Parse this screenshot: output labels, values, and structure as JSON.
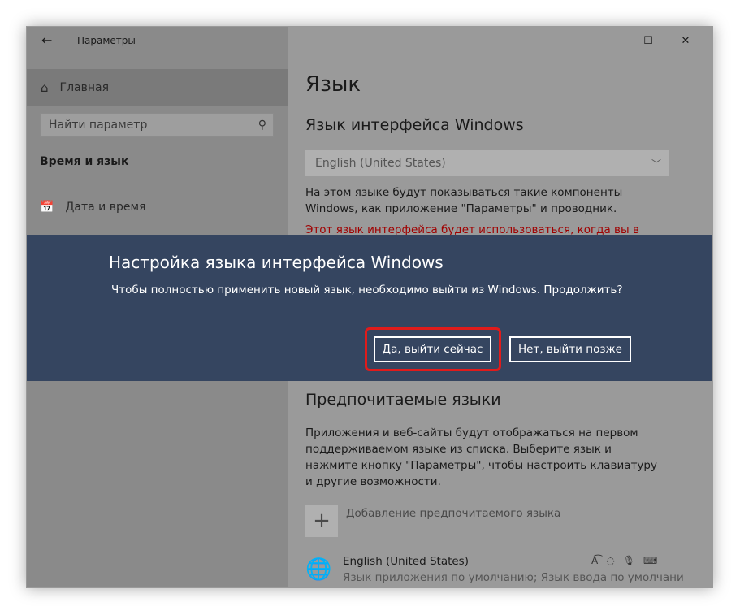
{
  "window": {
    "title": "Параметры",
    "back_glyph": "←",
    "controls": {
      "minimize": "—",
      "maximize": "☐",
      "close": "✕"
    }
  },
  "sidebar": {
    "home_label": "Главная",
    "search_placeholder": "Найти параметр",
    "section_title": "Время и язык",
    "items": [
      {
        "label": "Дата и время",
        "icon": "calendar-clock-icon"
      }
    ]
  },
  "main": {
    "heading": "Язык",
    "interface_language_heading": "Язык интерфейса Windows",
    "interface_language_value": "English (United States)",
    "interface_language_desc": "На этом языке будут показываться такие компоненты Windows, как приложение \"Параметры\" и проводник.",
    "interface_language_warning": "Этот язык интерфейса будет использоваться, когда вы в",
    "preferred_heading": "Предпочитаемые языки",
    "preferred_desc": "Приложения и веб-сайты будут отображаться на первом поддерживаемом языке из списка. Выберите язык и нажмите кнопку \"Параметры\", чтобы настроить клавиатуру и другие возможности.",
    "add_language_label": "Добавление предпочитаемого языка",
    "languages": [
      {
        "name": "English (United States)",
        "subtitle": "Язык приложения по умолчанию; Язык ввода по умолчани"
      }
    ]
  },
  "dialog": {
    "title": "Настройка языка интерфейса Windows",
    "message": "Чтобы полностью применить новый язык, необходимо выйти из Windows. Продолжить?",
    "yes_label": "Да, выйти сейчас",
    "no_label": "Нет, выйти позже"
  },
  "colors": {
    "dialog_bg": "#354560",
    "highlight": "#e01b1b",
    "warning_text": "#a00000"
  }
}
